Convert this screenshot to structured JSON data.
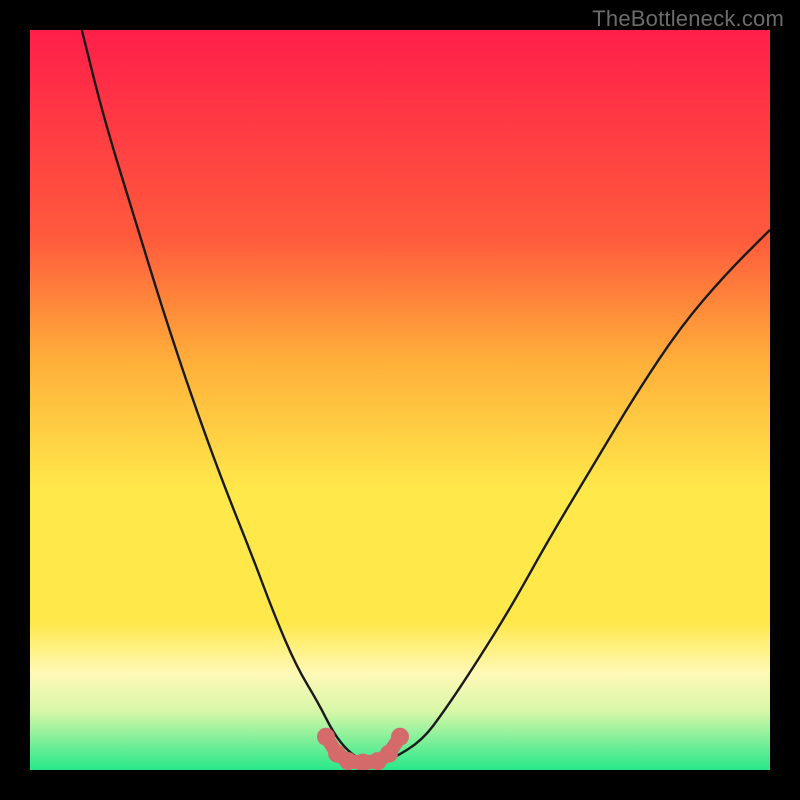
{
  "watermark": "TheBottleneck.com",
  "colors": {
    "frame": "#000000",
    "curve": "#1a1a1a",
    "marker": "#d46a6a",
    "gradient_top": "#ff1f4a",
    "gradient_mid1": "#ffb03a",
    "gradient_mid2": "#ffe84a",
    "gradient_mid3": "#fff9b8",
    "gradient_bottom": "#27e88a"
  },
  "chart_data": {
    "type": "line",
    "title": "",
    "xlabel": "",
    "ylabel": "",
    "xlim": [
      0,
      100
    ],
    "ylim": [
      0,
      100
    ],
    "series": [
      {
        "name": "bottleneck-curve",
        "x": [
          7,
          10,
          14,
          18,
          22,
          26,
          30,
          33,
          36,
          39,
          41,
          43,
          45,
          47,
          49,
          53,
          56,
          60,
          65,
          70,
          76,
          82,
          88,
          94,
          100
        ],
        "values": [
          100,
          88,
          75,
          62,
          50,
          39,
          29,
          21,
          14,
          9,
          5,
          2.5,
          1.2,
          1.0,
          1.5,
          4,
          8,
          14,
          22,
          31,
          41,
          51,
          60,
          67,
          73
        ]
      }
    ],
    "markers": {
      "name": "flat-minimum",
      "x": [
        40,
        41.5,
        43,
        45,
        47,
        48.5,
        50
      ],
      "values": [
        4.5,
        2.2,
        1.2,
        1.0,
        1.2,
        2.2,
        4.5
      ]
    },
    "gradient_bands_pct_from_top": [
      0,
      45,
      70,
      84,
      90,
      100
    ]
  }
}
